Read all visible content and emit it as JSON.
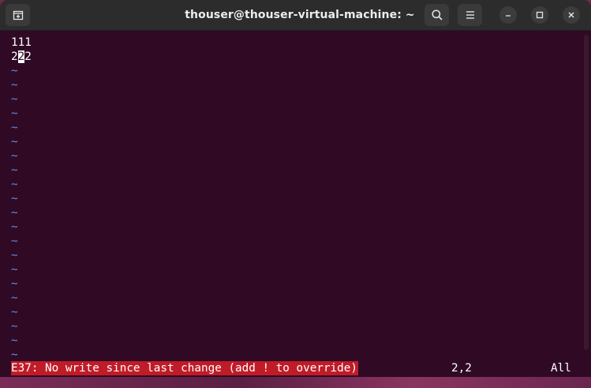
{
  "window": {
    "title": "thouser@thouser-virtual-machine: ~"
  },
  "titlebar": {
    "new_tab_icon": "new-tab-icon",
    "search_icon": "search-icon",
    "menu_icon": "hamburger-menu-icon",
    "minimize_icon": "minimize-icon",
    "maximize_icon": "maximize-icon",
    "close_icon": "close-icon"
  },
  "editor": {
    "line1": "111",
    "line2_before": "2",
    "line2_cursor": "2",
    "line2_after": "2",
    "tilde": "~"
  },
  "statusline": {
    "error": "E37: No write since last change (add ! to override)",
    "position": "2,2",
    "scroll": "All"
  },
  "colors": {
    "terminal_bg": "#300a24",
    "tilde": "#5f8de8",
    "error_bg": "#c01c28"
  }
}
